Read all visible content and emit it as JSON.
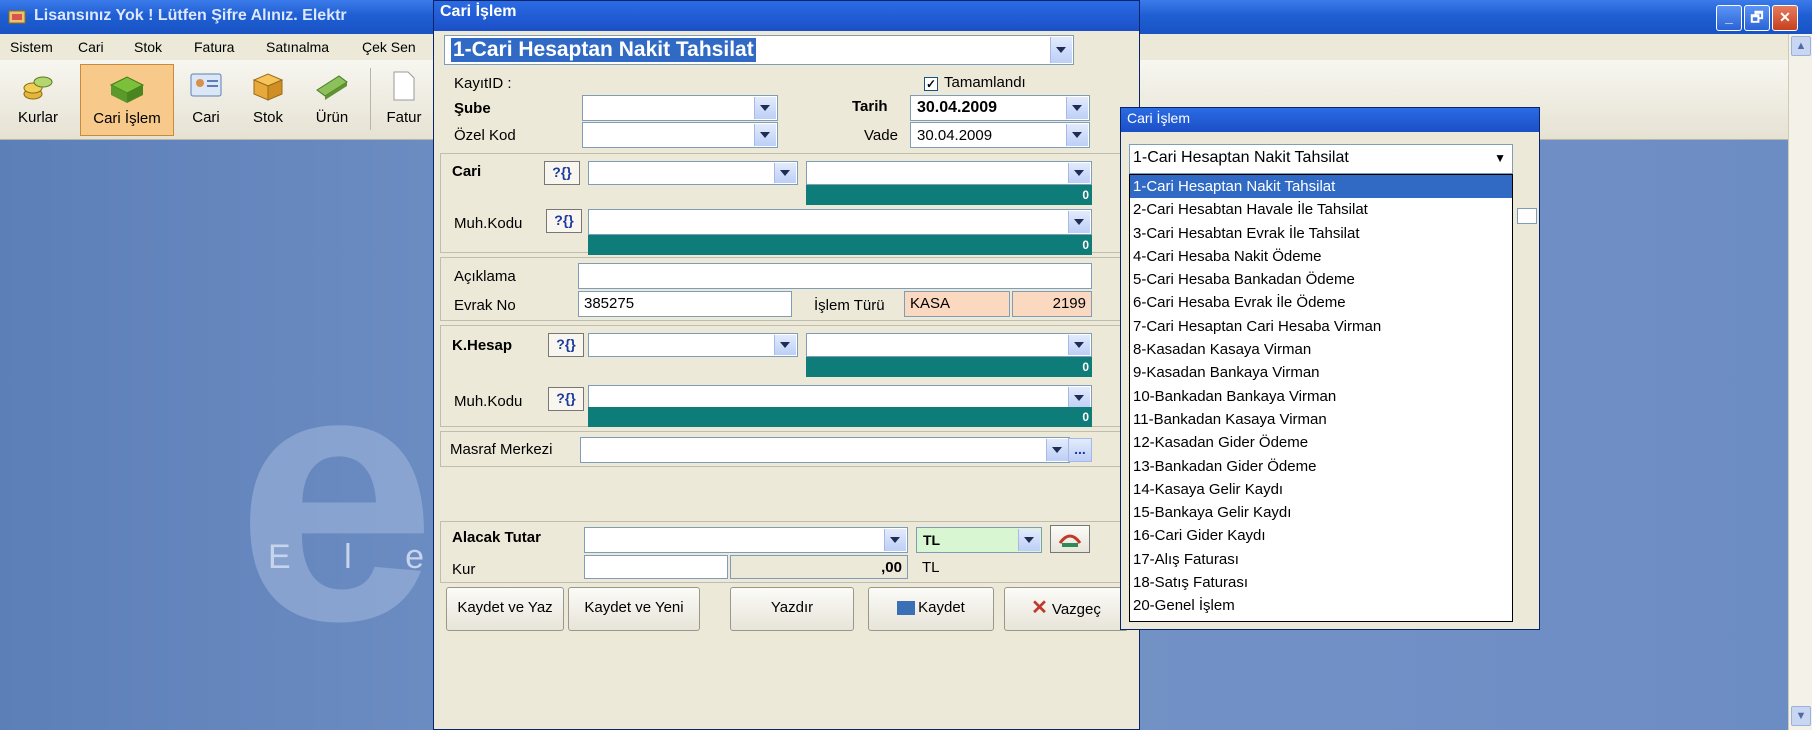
{
  "main_window": {
    "title": "Lisansınız Yok ! Lütfen Şifre Alınız. Elektr",
    "controls": [
      "_",
      "🗗",
      "✕"
    ]
  },
  "menu": [
    "Sistem",
    "Cari",
    "Stok",
    "Fatura",
    "Satınalma",
    "Çek Sen"
  ],
  "toolbar": [
    "Kurlar",
    "Cari İşlem",
    "Cari",
    "Stok",
    "Ürün",
    "Fatur"
  ],
  "desktop": {
    "logo_letter": "e",
    "logo_text": "E l e k t r"
  },
  "form": {
    "title": "Cari İşlem",
    "type_selected": "1-Cari Hesaptan Nakit Tahsilat",
    "kayit_label": "KayıtID :",
    "tamamlandi_label": "Tamamlandı",
    "tamamlandi_checked": true,
    "sube_label": "Şube",
    "ozel_kod_label": "Özel Kod",
    "tarih_label": "Tarih",
    "tarih_value": "30.04.2009",
    "vade_label": "Vade",
    "vade_value": "30.04.2009",
    "cari_label": "Cari",
    "cari_balance": "0",
    "muh_kodu_label": "Muh.Kodu",
    "muh_balance": "0",
    "aciklama_label": "Açıklama",
    "evrak_no_label": "Evrak No",
    "evrak_no_value": "385275",
    "islem_turu_label": "İşlem Türü",
    "islem_turu_value": "KASA",
    "islem_turu_code": "2199",
    "khesap_label": "K.Hesap",
    "khesap_balance": "0",
    "muh_kodu2_label": "Muh.Kodu",
    "muh2_balance": "0",
    "masraf_label": "Masraf Merkezi",
    "masraf_ellipsis": "...",
    "alacak_label": "Alacak Tutar",
    "currency": "TL",
    "kur_label": "Kur",
    "kur_value": ",00",
    "kur_currency": "TL",
    "quest_icon": "?{}",
    "buttons": {
      "kaydet_yaz": "Kaydet ve Yaz",
      "kaydet_yeni": "Kaydet ve Yeni",
      "yazdir": "Yazdır",
      "kaydet": "Kaydet",
      "vazgec": "Vazgeç"
    }
  },
  "popup": {
    "title": "Cari İşlem",
    "selected": "1-Cari Hesaptan Nakit Tahsilat",
    "options": [
      "1-Cari Hesaptan Nakit Tahsilat",
      "2-Cari Hesabtan Havale İle Tahsilat",
      "3-Cari Hesabtan Evrak İle Tahsilat",
      "4-Cari Hesaba Nakit Ödeme",
      "5-Cari Hesaba Bankadan Ödeme",
      "6-Cari Hesaba Evrak İle Ödeme",
      "7-Cari Hesaptan Cari Hesaba Virman",
      "8-Kasadan Kasaya Virman",
      "9-Kasadan Bankaya Virman",
      "10-Bankadan Bankaya Virman",
      "11-Bankadan Kasaya Virman",
      "12-Kasadan Gider Ödeme",
      "13-Bankadan Gider Ödeme",
      "14-Kasaya Gelir Kaydı",
      "15-Bankaya Gelir Kaydı",
      "16-Cari Gider Kaydı",
      "17-Alış Faturası",
      "18-Satış Faturası",
      "20-Genel İşlem"
    ]
  }
}
